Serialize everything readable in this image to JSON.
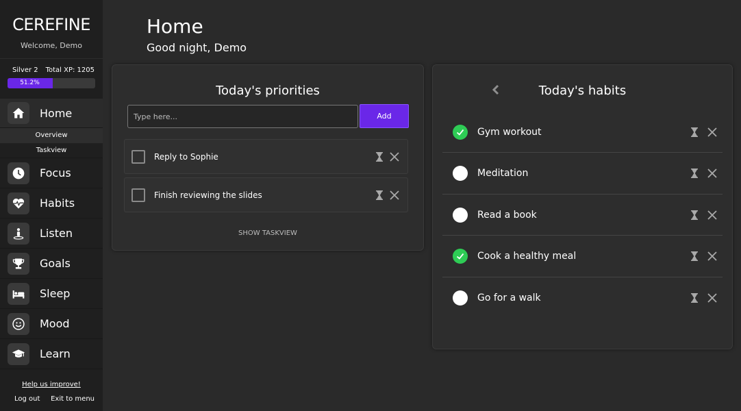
{
  "app": {
    "brand": "CEREFINE",
    "welcome": "Welcome, Demo",
    "rank": "Silver 2",
    "total_xp": "Total XP: 1205",
    "xp_progress_label": "51.2%",
    "xp_progress": 0.512
  },
  "nav": {
    "items": [
      {
        "label": "Home",
        "icon": "home-icon"
      },
      {
        "label": "Focus",
        "icon": "clock-icon"
      },
      {
        "label": "Habits",
        "icon": "heartbeat-icon"
      },
      {
        "label": "Listen",
        "icon": "person-icon"
      },
      {
        "label": "Goals",
        "icon": "trophy-icon"
      },
      {
        "label": "Sleep",
        "icon": "bed-icon"
      },
      {
        "label": "Mood",
        "icon": "smiley-icon"
      },
      {
        "label": "Learn",
        "icon": "graduation-cap-icon"
      }
    ],
    "sub_items": [
      "Overview",
      "Taskview"
    ]
  },
  "footer": {
    "help": "Help us improve!",
    "logout": "Log out",
    "exit": "Exit to menu"
  },
  "header": {
    "title": "Home",
    "greeting": "Good night, Demo"
  },
  "priorities": {
    "title": "Today's priorities",
    "input_placeholder": "Type here...",
    "add_label": "Add",
    "tasks": [
      "Reply to Sophie",
      "Finish reviewing the slides"
    ],
    "show_taskview": "SHOW TASKVIEW"
  },
  "habits": {
    "title": "Today's habits",
    "items": [
      {
        "label": "Gym workout",
        "done": true
      },
      {
        "label": "Meditation",
        "done": false
      },
      {
        "label": "Read a book",
        "done": false
      },
      {
        "label": "Cook a healthy meal",
        "done": true
      },
      {
        "label": "Go for a walk",
        "done": false
      }
    ]
  },
  "colors": {
    "accent": "#6a27e8",
    "done": "#2ecc55",
    "background": "#2a2a2a",
    "sidebar": "#1f1f1f"
  }
}
